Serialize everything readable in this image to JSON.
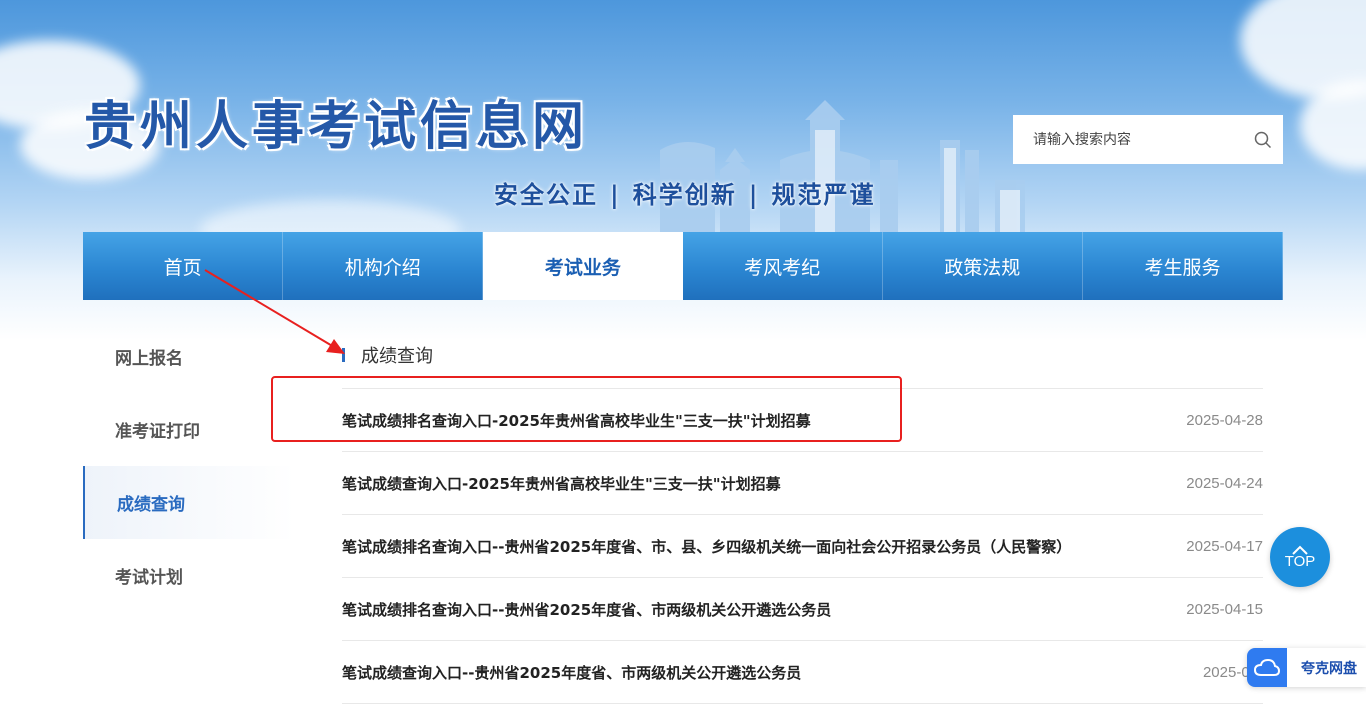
{
  "header": {
    "site_title": "贵州人事考试信息网",
    "slogan": [
      "安全公正",
      "科学创新",
      "规范严谨"
    ],
    "slogan_separator": "|",
    "search": {
      "placeholder": "请输入搜索内容",
      "value": "",
      "icon": "search-icon"
    }
  },
  "nav": {
    "items": [
      {
        "label": "首页",
        "active": false
      },
      {
        "label": "机构介绍",
        "active": false
      },
      {
        "label": "考试业务",
        "active": true
      },
      {
        "label": "考风考纪",
        "active": false
      },
      {
        "label": "政策法规",
        "active": false
      },
      {
        "label": "考生服务",
        "active": false
      }
    ]
  },
  "sidebar": {
    "items": [
      {
        "label": "网上报名",
        "active": false
      },
      {
        "label": "准考证打印",
        "active": false
      },
      {
        "label": "成绩查询",
        "active": true
      },
      {
        "label": "考试计划",
        "active": false
      }
    ]
  },
  "main": {
    "section_title": "成绩查询",
    "rows": [
      {
        "title": "笔试成绩排名查询入口-2025年贵州省高校毕业生\"三支一扶\"计划招募",
        "date": "2025-04-28"
      },
      {
        "title": "笔试成绩查询入口-2025年贵州省高校毕业生\"三支一扶\"计划招募",
        "date": "2025-04-24"
      },
      {
        "title": "笔试成绩排名查询入口--贵州省2025年度省、市、县、乡四级机关统一面向社会公开招录公务员（人民警察）",
        "date": "2025-04-17"
      },
      {
        "title": "笔试成绩排名查询入口--贵州省2025年度省、市两级机关公开遴选公务员",
        "date": "2025-04-15"
      },
      {
        "title": "笔试成绩查询入口--贵州省2025年度省、市两级机关公开遴选公务员",
        "date": "2025-04-"
      }
    ]
  },
  "floating": {
    "top_label": "TOP",
    "quark_label": "夸克网盘"
  },
  "colors": {
    "brand_blue": "#2a6bc0",
    "nav_blue": "#2b86d2",
    "annotation_red": "#e8201f",
    "top_button": "#1c8fdd"
  }
}
